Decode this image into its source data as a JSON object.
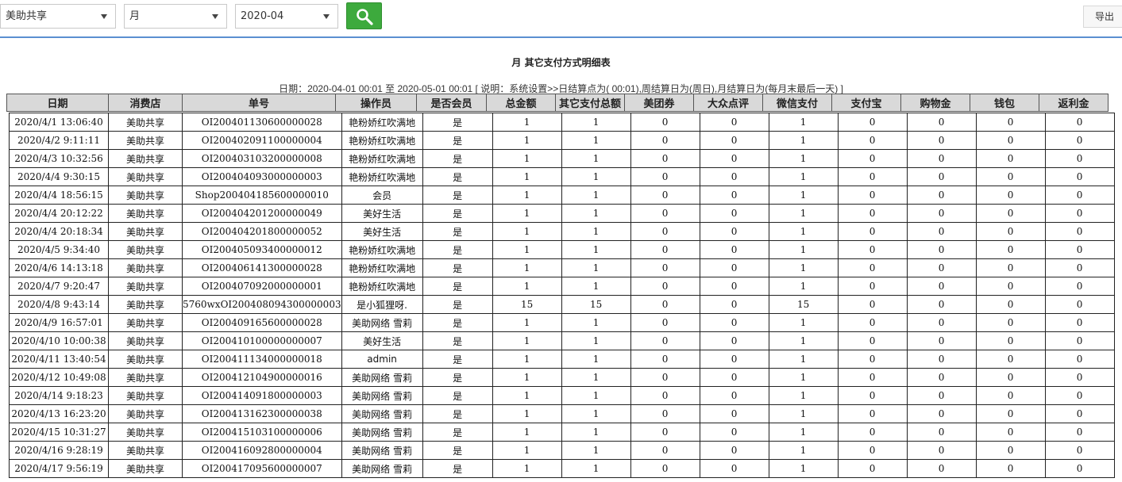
{
  "toolbar": {
    "store_select": "美助共享",
    "period_select": "月",
    "date_select": "2020-04",
    "export_label": "导出"
  },
  "report": {
    "title": "月 其它支付方式明细表",
    "date_note": "日期：2020-04-01 00:01 至 2020-05-01 00:01 [ 说明：系统设置>>日结算点为( 00:01),周结算日为(周日),月结算日为(每月末最后一天) ]"
  },
  "table": {
    "headers": [
      "日期",
      "消费店",
      "单号",
      "操作员",
      "是否会员",
      "总金额",
      "其它支付总额",
      "美团券",
      "大众点评",
      "微信支付",
      "支付宝",
      "购物金",
      "钱包",
      "返利金"
    ],
    "rows": [
      [
        "2020/4/1 13:06:40",
        "美助共享",
        "OI200401130600000028",
        "艳粉娇红吹满地",
        "是",
        "1",
        "1",
        "0",
        "0",
        "1",
        "0",
        "0",
        "0",
        "0"
      ],
      [
        "2020/4/2 9:11:11",
        "美助共享",
        "OI200402091100000004",
        "艳粉娇红吹满地",
        "是",
        "1",
        "1",
        "0",
        "0",
        "1",
        "0",
        "0",
        "0",
        "0"
      ],
      [
        "2020/4/3 10:32:56",
        "美助共享",
        "OI200403103200000008",
        "艳粉娇红吹满地",
        "是",
        "1",
        "1",
        "0",
        "0",
        "1",
        "0",
        "0",
        "0",
        "0"
      ],
      [
        "2020/4/4 9:30:15",
        "美助共享",
        "OI200404093000000003",
        "艳粉娇红吹满地",
        "是",
        "1",
        "1",
        "0",
        "0",
        "1",
        "0",
        "0",
        "0",
        "0"
      ],
      [
        "2020/4/4 18:56:15",
        "美助共享",
        "Shop200404185600000010",
        "会员",
        "是",
        "1",
        "1",
        "0",
        "0",
        "1",
        "0",
        "0",
        "0",
        "0"
      ],
      [
        "2020/4/4 20:12:22",
        "美助共享",
        "OI200404201200000049",
        "美好生活",
        "是",
        "1",
        "1",
        "0",
        "0",
        "1",
        "0",
        "0",
        "0",
        "0"
      ],
      [
        "2020/4/4 20:18:34",
        "美助共享",
        "OI200404201800000052",
        "美好生活",
        "是",
        "1",
        "1",
        "0",
        "0",
        "1",
        "0",
        "0",
        "0",
        "0"
      ],
      [
        "2020/4/5 9:34:40",
        "美助共享",
        "OI200405093400000012",
        "艳粉娇红吹满地",
        "是",
        "1",
        "1",
        "0",
        "0",
        "1",
        "0",
        "0",
        "0",
        "0"
      ],
      [
        "2020/4/6 14:13:18",
        "美助共享",
        "OI200406141300000028",
        "艳粉娇红吹满地",
        "是",
        "1",
        "1",
        "0",
        "0",
        "1",
        "0",
        "0",
        "0",
        "0"
      ],
      [
        "2020/4/7 9:20:47",
        "美助共享",
        "OI200407092000000001",
        "艳粉娇红吹满地",
        "是",
        "1",
        "1",
        "0",
        "0",
        "1",
        "0",
        "0",
        "0",
        "0"
      ],
      [
        "2020/4/8 9:43:14",
        "美助共享",
        "5760wxOI200408094300000003",
        "是小狐狸呀.",
        "是",
        "15",
        "15",
        "0",
        "0",
        "15",
        "0",
        "0",
        "0",
        "0"
      ],
      [
        "2020/4/9 16:57:01",
        "美助共享",
        "OI200409165600000028",
        "美助网络 雪莉",
        "是",
        "1",
        "1",
        "0",
        "0",
        "1",
        "0",
        "0",
        "0",
        "0"
      ],
      [
        "2020/4/10 10:00:38",
        "美助共享",
        "OI200410100000000007",
        "美好生活",
        "是",
        "1",
        "1",
        "0",
        "0",
        "1",
        "0",
        "0",
        "0",
        "0"
      ],
      [
        "2020/4/11 13:40:54",
        "美助共享",
        "OI200411134000000018",
        "admin",
        "是",
        "1",
        "1",
        "0",
        "0",
        "1",
        "0",
        "0",
        "0",
        "0"
      ],
      [
        "2020/4/12 10:49:08",
        "美助共享",
        "OI200412104900000016",
        "美助网络 雪莉",
        "是",
        "1",
        "1",
        "0",
        "0",
        "1",
        "0",
        "0",
        "0",
        "0"
      ],
      [
        "2020/4/14 9:18:23",
        "美助共享",
        "OI200414091800000003",
        "美助网络 雪莉",
        "是",
        "1",
        "1",
        "0",
        "0",
        "1",
        "0",
        "0",
        "0",
        "0"
      ],
      [
        "2020/4/13 16:23:20",
        "美助共享",
        "OI200413162300000038",
        "美助网络 雪莉",
        "是",
        "1",
        "1",
        "0",
        "0",
        "1",
        "0",
        "0",
        "0",
        "0"
      ],
      [
        "2020/4/15 10:31:27",
        "美助共享",
        "OI200415103100000006",
        "美助网络 雪莉",
        "是",
        "1",
        "1",
        "0",
        "0",
        "1",
        "0",
        "0",
        "0",
        "0"
      ],
      [
        "2020/4/16 9:28:19",
        "美助共享",
        "OI200416092800000004",
        "美助网络 雪莉",
        "是",
        "1",
        "1",
        "0",
        "0",
        "1",
        "0",
        "0",
        "0",
        "0"
      ],
      [
        "2020/4/17 9:56:19",
        "美助共享",
        "OI200417095600000007",
        "美助网络 雪莉",
        "是",
        "1",
        "1",
        "0",
        "0",
        "1",
        "0",
        "0",
        "0",
        "0"
      ]
    ]
  },
  "colors": {
    "accent_line": "#5a8fd0",
    "search_button": "#3daa3d",
    "header_bg": "#d9d9d9"
  },
  "icons": {
    "search": "search-icon",
    "dropdown": "chevron-down-icon"
  }
}
